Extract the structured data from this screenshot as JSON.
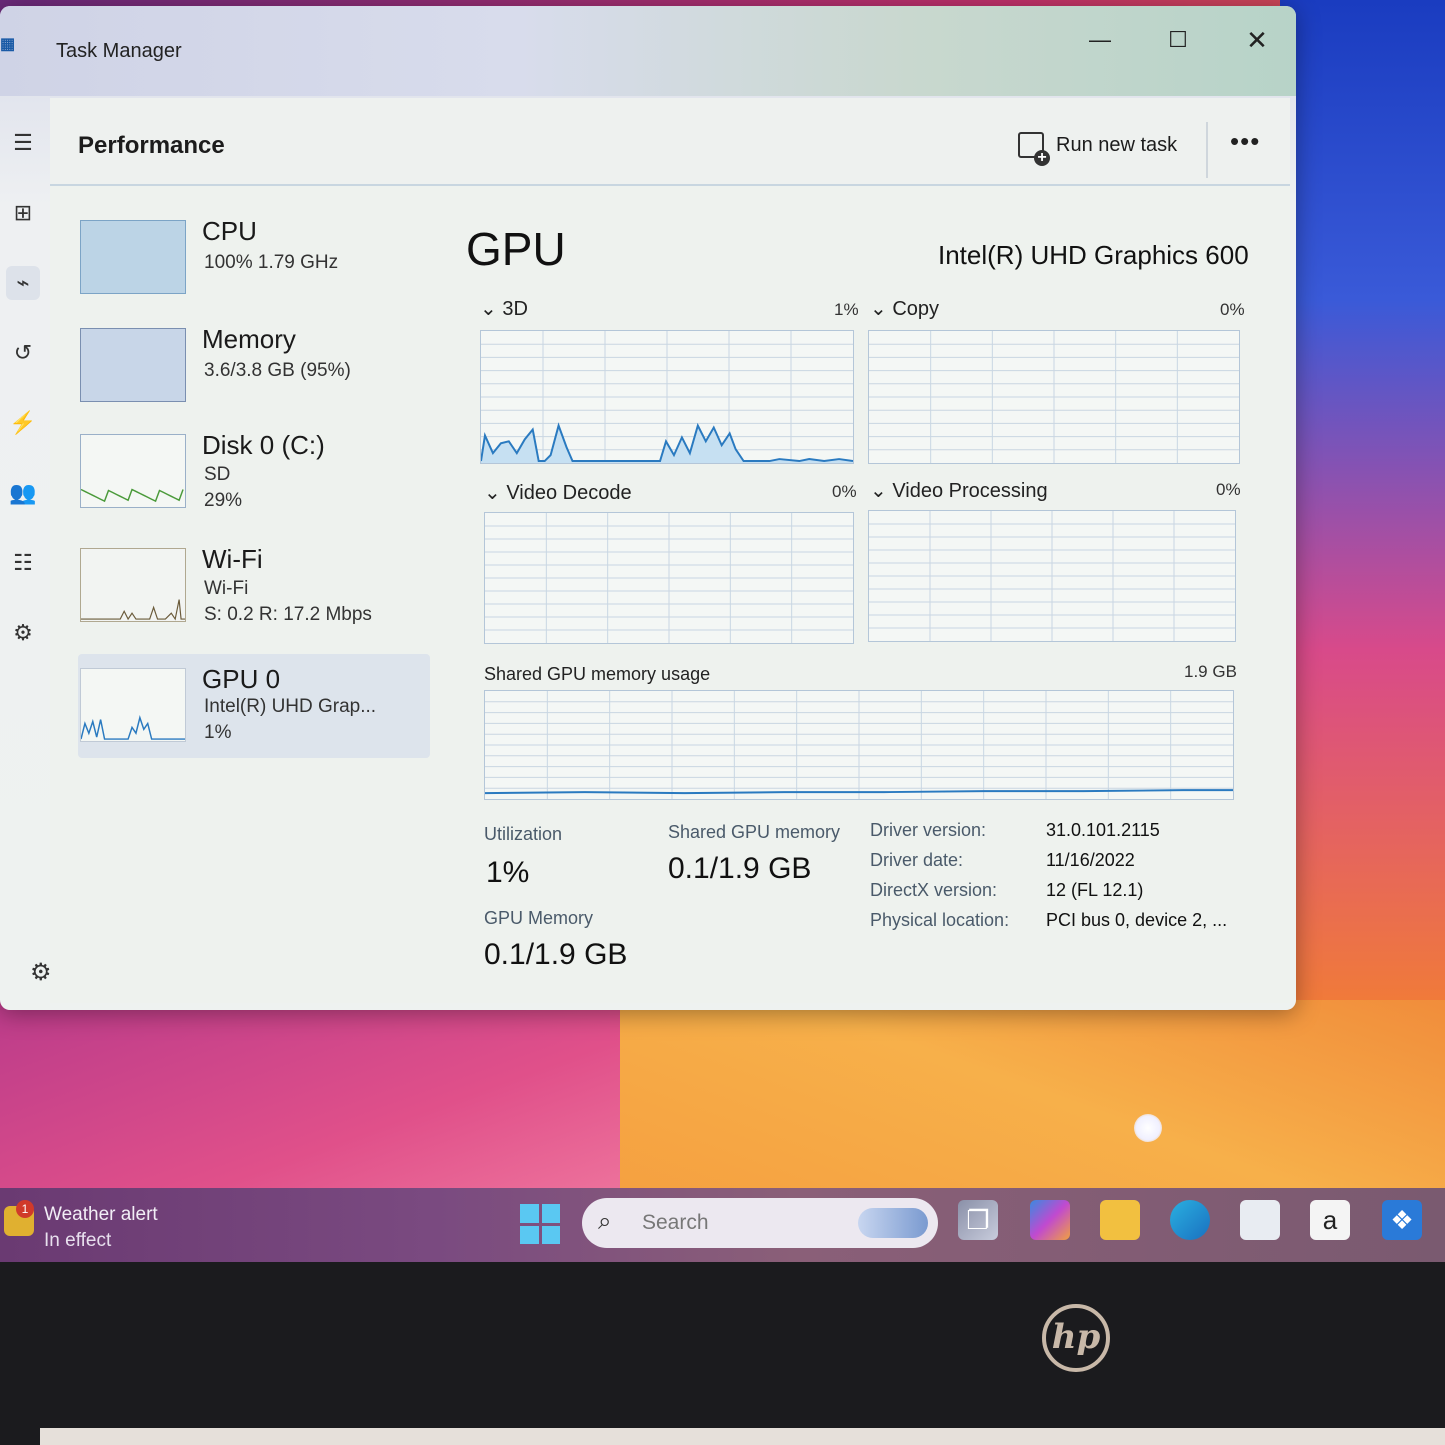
{
  "window": {
    "title": "Task Manager",
    "minimize_glyph": "—",
    "maximize_glyph": "☐",
    "close_glyph": "✕"
  },
  "nav": {
    "icons": [
      "hamburger-icon",
      "processes-icon",
      "performance-icon",
      "app-history-icon",
      "startup-apps-icon",
      "users-icon",
      "details-icon",
      "services-icon"
    ],
    "settings_icon": "gear-icon"
  },
  "header": {
    "title": "Performance",
    "run_new_task": "Run new task",
    "more": "•••"
  },
  "resources": [
    {
      "name": "CPU",
      "line1": "100%  1.79 GHz",
      "line2": ""
    },
    {
      "name": "Memory",
      "line1": "3.6/3.8 GB (95%)",
      "line2": ""
    },
    {
      "name": "Disk 0 (C:)",
      "line1": "SD",
      "line2": "29%"
    },
    {
      "name": "Wi-Fi",
      "line1": "Wi-Fi",
      "line2": "S: 0.2  R: 17.2 Mbps"
    },
    {
      "name": "GPU 0",
      "line1": "Intel(R) UHD Grap...",
      "line2": "1%"
    }
  ],
  "gpu": {
    "title": "GPU",
    "model": "Intel(R) UHD Graphics 600",
    "engines": [
      {
        "label": "3D",
        "pct": "1%"
      },
      {
        "label": "Copy",
        "pct": "0%"
      },
      {
        "label": "Video Decode",
        "pct": "0%"
      },
      {
        "label": "Video Processing",
        "pct": "0%"
      }
    ],
    "shared_memory_chart": {
      "label": "Shared GPU memory usage",
      "max": "1.9 GB"
    },
    "stats": {
      "utilization_label": "Utilization",
      "utilization_value": "1%",
      "shared_label": "Shared GPU memory",
      "shared_value": "0.1/1.9 GB",
      "gpu_memory_label": "GPU Memory",
      "gpu_memory_value": "0.1/1.9 GB"
    },
    "info": [
      {
        "key": "Driver version:",
        "value": "31.0.101.2115"
      },
      {
        "key": "Driver date:",
        "value": "11/16/2022"
      },
      {
        "key": "DirectX version:",
        "value": "12 (FL 12.1)"
      },
      {
        "key": "Physical location:",
        "value": "PCI bus 0, device 2, ..."
      }
    ]
  },
  "taskbar": {
    "weather_badge": "1",
    "weather_title": "Weather alert",
    "weather_sub": "In effect",
    "search_placeholder": "Search",
    "icons": [
      "start-icon",
      "task-view-icon",
      "copilot-icon",
      "file-explorer-icon",
      "edge-icon",
      "store-icon",
      "amazon-icon",
      "dropbox-icon"
    ],
    "amazon_glyph": "a"
  },
  "bezel": {
    "logo": "hp"
  },
  "colors": {
    "chart_line": "#2a7ac0",
    "chart_fill": "#c6e0f2",
    "disk_line": "#4a9a3a",
    "grid": "#c9d6e2"
  }
}
